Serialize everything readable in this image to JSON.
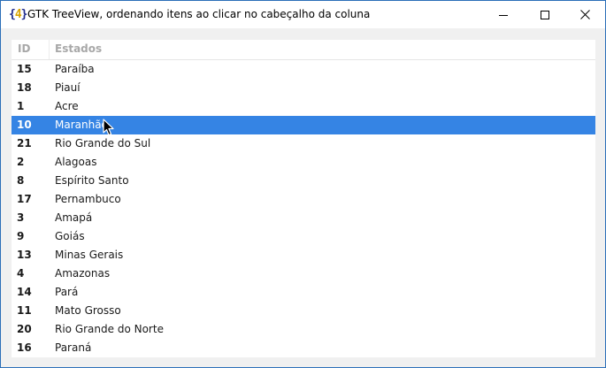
{
  "window": {
    "title": "GTK TreeView, ordenando itens ao clicar no cabeçalho da coluna",
    "icon": {
      "name": "app-logo-icon",
      "brace_open": "{",
      "number": "4",
      "brace_close": "}"
    },
    "controls": {
      "minimize": "minimize-icon",
      "maximize": "maximize-icon",
      "close": "close-icon"
    }
  },
  "table": {
    "columns": [
      "ID",
      "Estados"
    ],
    "rows": [
      {
        "id": "15",
        "estado": "Paraíba"
      },
      {
        "id": "18",
        "estado": "Piauí"
      },
      {
        "id": "1",
        "estado": "Acre"
      },
      {
        "id": "10",
        "estado": "Maranhão",
        "selected": true
      },
      {
        "id": "21",
        "estado": "Rio Grande do Sul"
      },
      {
        "id": "2",
        "estado": "Alagoas"
      },
      {
        "id": "8",
        "estado": "Espírito Santo"
      },
      {
        "id": "17",
        "estado": "Pernambuco"
      },
      {
        "id": "3",
        "estado": "Amapá"
      },
      {
        "id": "9",
        "estado": "Goiás"
      },
      {
        "id": "13",
        "estado": "Minas Gerais"
      },
      {
        "id": "4",
        "estado": "Amazonas"
      },
      {
        "id": "14",
        "estado": "Pará"
      },
      {
        "id": "11",
        "estado": "Mato Grosso"
      },
      {
        "id": "20",
        "estado": "Rio Grande do Norte"
      },
      {
        "id": "16",
        "estado": "Paraná"
      }
    ]
  },
  "colors": {
    "selection": "#3584e4",
    "header_text": "#a8a8a8",
    "border": "#2b6fb8"
  }
}
